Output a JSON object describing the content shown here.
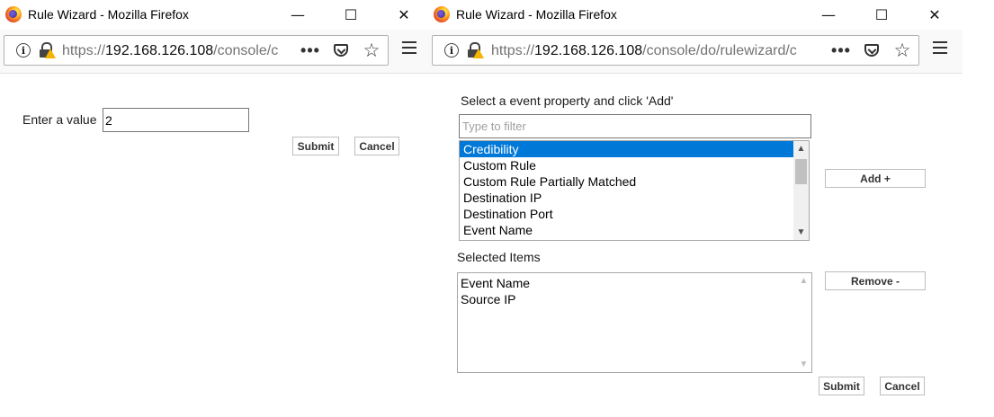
{
  "windows": {
    "left": {
      "title": "Rule Wizard - Mozilla Firefox",
      "url_prefix": "https://",
      "url_host": "192.168.126.108",
      "url_path": "/console/c",
      "page": {
        "value_label": "Enter a value",
        "value_input": "2",
        "submit_label": "Submit",
        "cancel_label": "Cancel"
      }
    },
    "right": {
      "title": "Rule Wizard - Mozilla Firefox",
      "url_prefix": "https://",
      "url_host": "192.168.126.108",
      "url_path": "/console/do/rulewizard/c",
      "page": {
        "instruction": "Select a event property and click 'Add'",
        "filter_placeholder": "Type to filter",
        "properties": [
          "Credibility",
          "Custom Rule",
          "Custom Rule Partially Matched",
          "Destination IP",
          "Destination Port",
          "Event Name"
        ],
        "selected_property": "Credibility",
        "add_label": "Add +",
        "selected_items_label": "Selected Items",
        "selected_items": [
          "Event Name",
          "Source IP"
        ],
        "remove_label": "Remove -",
        "submit_label": "Submit",
        "cancel_label": "Cancel"
      }
    }
  },
  "controls": {
    "minimize": "—",
    "maximize": "☐",
    "close": "✕",
    "more": "•••",
    "bookmark": "☆"
  },
  "colors": {
    "selection": "#0078d7",
    "warning": "#f4b400"
  }
}
